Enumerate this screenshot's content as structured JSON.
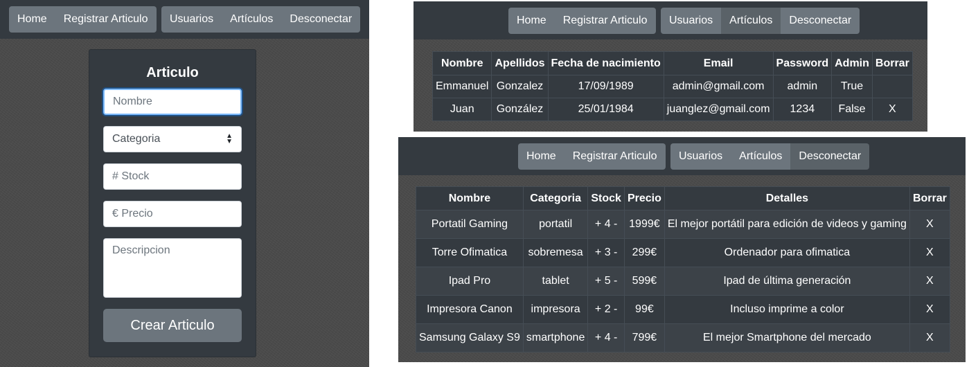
{
  "nav": {
    "home": "Home",
    "registrar": "Registrar Articulo",
    "usuarios": "Usuarios",
    "articulos": "Artículos",
    "desconectar": "Desconectar"
  },
  "form": {
    "title": "Articulo",
    "nombre_placeholder": "Nombre",
    "categoria_value": "Categoria",
    "stock_placeholder": "# Stock",
    "precio_placeholder": "€ Precio",
    "descripcion_placeholder": "Descripcion",
    "submit_label": "Crear Articulo"
  },
  "users_table": {
    "headers": [
      "Nombre",
      "Apellidos",
      "Fecha de nacimiento",
      "Email",
      "Password",
      "Admin",
      "Borrar"
    ],
    "rows": [
      [
        "Emmanuel",
        "Gonzalez",
        "17/09/1989",
        "admin@gmail.com",
        "admin",
        "True",
        ""
      ],
      [
        "Juan",
        "González",
        "25/01/1984",
        "juanglez@gmail.com",
        "1234",
        "False",
        "X"
      ]
    ]
  },
  "articles_table": {
    "headers": [
      "Nombre",
      "Categoria",
      "Stock",
      "Precio",
      "Detalles",
      "Borrar"
    ],
    "rows": [
      [
        "Portatil Gaming",
        "portatil",
        "+ 4 -",
        "1999€",
        "El mejor portátil para edición de videos y gaming",
        "X"
      ],
      [
        "Torre Ofimatica",
        "sobremesa",
        "+ 3 -",
        "299€",
        "Ordenador para ofimatica",
        "X"
      ],
      [
        "Ipad Pro",
        "tablet",
        "+ 5 -",
        "599€",
        "Ipad de última generación",
        "X"
      ],
      [
        "Impresora Canon",
        "impresora",
        "+ 2 -",
        "99€",
        "Incluso imprime a color",
        "X"
      ],
      [
        "Samsung Galaxy S9",
        "smartphone",
        "+ 4 -",
        "799€",
        "El mejor Smartphone del mercado",
        "X"
      ]
    ]
  },
  "colors": {
    "navbar": "#343a40",
    "button": "#6c757d",
    "button_active": "#5a6268",
    "table_bg": "#343a40",
    "focus_border": "#80bdff"
  }
}
